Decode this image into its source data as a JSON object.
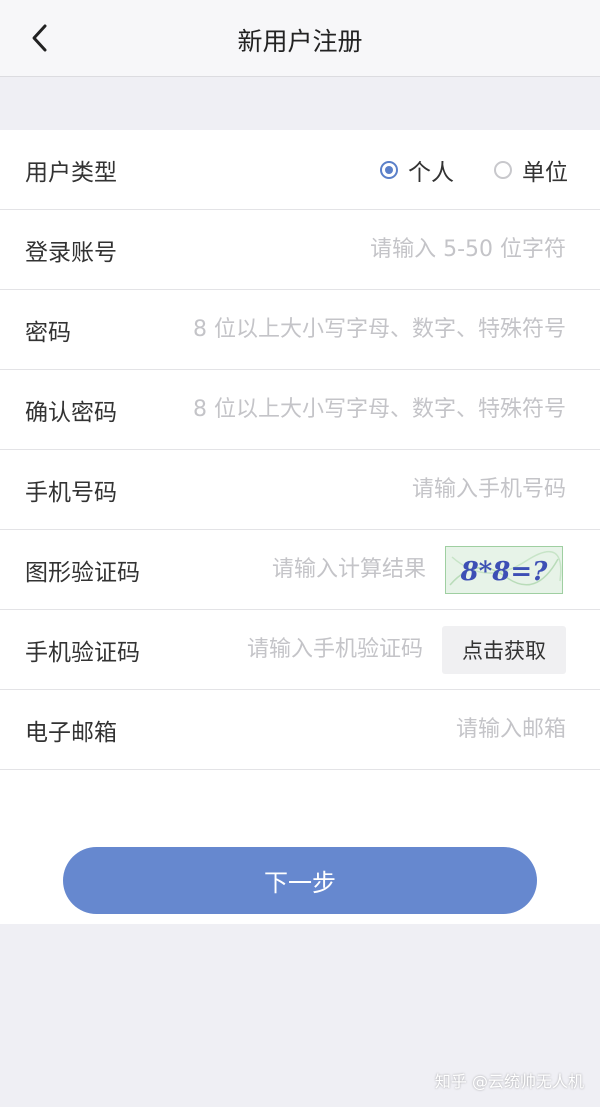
{
  "header": {
    "title": "新用户注册",
    "back_icon": "chevron-left-icon"
  },
  "form": {
    "user_type": {
      "label": "用户类型",
      "options": [
        {
          "label": "个人",
          "selected": true
        },
        {
          "label": "单位",
          "selected": false
        }
      ]
    },
    "account": {
      "label": "登录账号",
      "placeholder": "请输入 5-50 位字符",
      "value": ""
    },
    "password": {
      "label": "密码",
      "placeholder": "8 位以上大小写字母、数字、特殊符号",
      "value": ""
    },
    "confirm_password": {
      "label": "确认密码",
      "placeholder": "8 位以上大小写字母、数字、特殊符号",
      "value": ""
    },
    "phone": {
      "label": "手机号码",
      "placeholder": "请输入手机号码",
      "value": ""
    },
    "captcha": {
      "label": "图形验证码",
      "placeholder": "请输入计算结果",
      "value": "",
      "image_text": "8*8=?"
    },
    "sms_code": {
      "label": "手机验证码",
      "placeholder": "请输入手机验证码",
      "value": "",
      "button_label": "点击获取"
    },
    "email": {
      "label": "电子邮箱",
      "placeholder": "请输入邮箱",
      "value": ""
    }
  },
  "next_button": {
    "label": "下一步"
  },
  "watermark": "知乎 @云统帅无人机",
  "colors": {
    "accent": "#6688cf",
    "radio": "#5b80c9",
    "background": "#efeff4"
  }
}
